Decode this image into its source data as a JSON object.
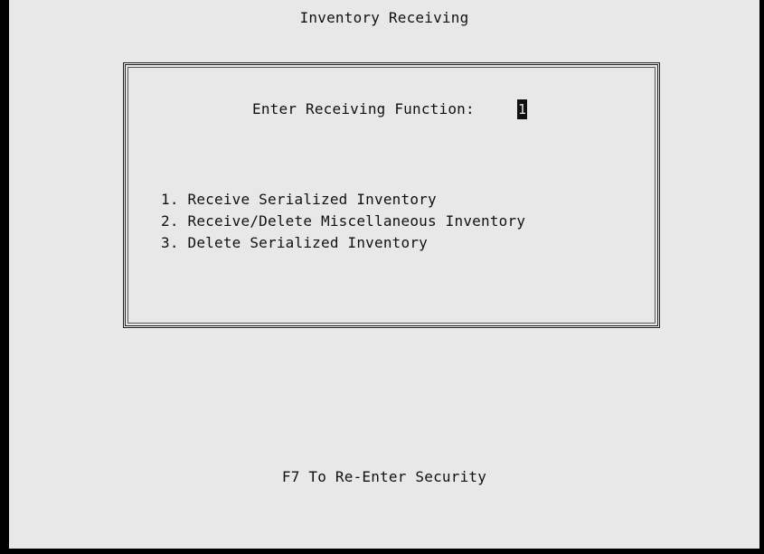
{
  "screen": {
    "title": "Inventory Receiving"
  },
  "dialog": {
    "prompt_label": "Enter Receiving Function:",
    "input_value": "1",
    "menu_items": [
      {
        "number": "1.",
        "label": "Receive Serialized Inventory"
      },
      {
        "number": "2.",
        "label": "Receive/Delete Miscellaneous Inventory"
      },
      {
        "number": "3.",
        "label": "Delete Serialized Inventory"
      }
    ]
  },
  "footer": {
    "hint": "F7 To Re-Enter Security"
  },
  "colors": {
    "background": "#e8e8e8",
    "frame": "#000000",
    "text": "#111111"
  }
}
